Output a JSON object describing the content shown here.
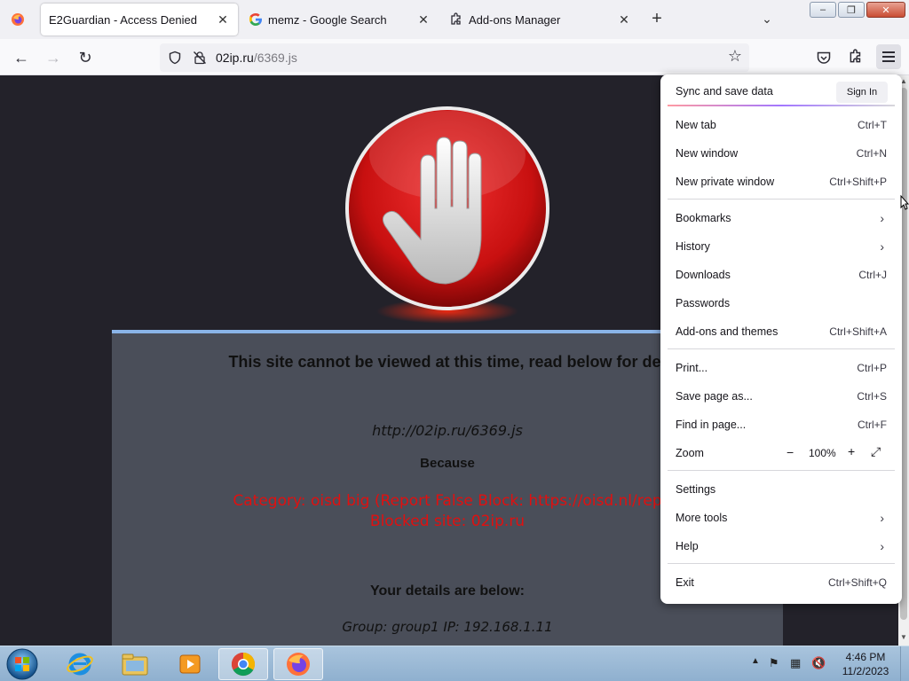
{
  "tabs": [
    {
      "label": "E2Guardian - Access Denied",
      "icon": "firefox-icon",
      "active": true
    },
    {
      "label": "memz - Google Search",
      "icon": "google-icon",
      "active": false
    },
    {
      "label": "Add-ons Manager",
      "icon": "puzzle-icon",
      "active": false
    }
  ],
  "navbar": {
    "url_host": "02ip.ru",
    "url_path": "/6369.js"
  },
  "page": {
    "title": "This site cannot be viewed at this time, read below for det",
    "blocked_url": "http://02ip.ru/6369.js",
    "because": "Because",
    "reason_line1": "Category: oisd big (Report False Block: https://oisd.nl/rep",
    "reason_line2": "Blocked site: 02ip.ru",
    "details_title": "Your details are below:",
    "details_line": "Group: group1   IP: 192.168.1.11"
  },
  "menu": {
    "sync_label": "Sync and save data",
    "signin_label": "Sign In",
    "items": [
      {
        "label": "New tab",
        "shortcut": "Ctrl+T"
      },
      {
        "label": "New window",
        "shortcut": "Ctrl+N"
      },
      {
        "label": "New private window",
        "shortcut": "Ctrl+Shift+P"
      },
      {
        "label": "Bookmarks",
        "shortcut": ""
      },
      {
        "label": "History",
        "shortcut": ""
      },
      {
        "label": "Downloads",
        "shortcut": "Ctrl+J"
      },
      {
        "label": "Passwords",
        "shortcut": ""
      },
      {
        "label": "Add-ons and themes",
        "shortcut": "Ctrl+Shift+A"
      },
      {
        "label": "Print...",
        "shortcut": "Ctrl+P"
      },
      {
        "label": "Save page as...",
        "shortcut": "Ctrl+S"
      },
      {
        "label": "Find in page...",
        "shortcut": "Ctrl+F"
      },
      {
        "label": "Zoom",
        "shortcut": ""
      },
      {
        "label": "Settings",
        "shortcut": ""
      },
      {
        "label": "More tools",
        "shortcut": ""
      },
      {
        "label": "Help",
        "shortcut": ""
      },
      {
        "label": "Exit",
        "shortcut": "Ctrl+Shift+Q"
      }
    ],
    "zoom_value": "100%"
  },
  "taskbar": {
    "time": "4:46 PM",
    "date": "11/2/2023",
    "apps": [
      "internet-explorer-icon",
      "file-explorer-icon",
      "media-player-icon",
      "chrome-icon",
      "firefox-icon"
    ]
  },
  "colors": {
    "page_bg": "#23222a",
    "panel_bg": "#4a4e59",
    "panel_accent": "#8ab4e8",
    "reason_red": "#e01010",
    "stop_red": "#d01818"
  }
}
